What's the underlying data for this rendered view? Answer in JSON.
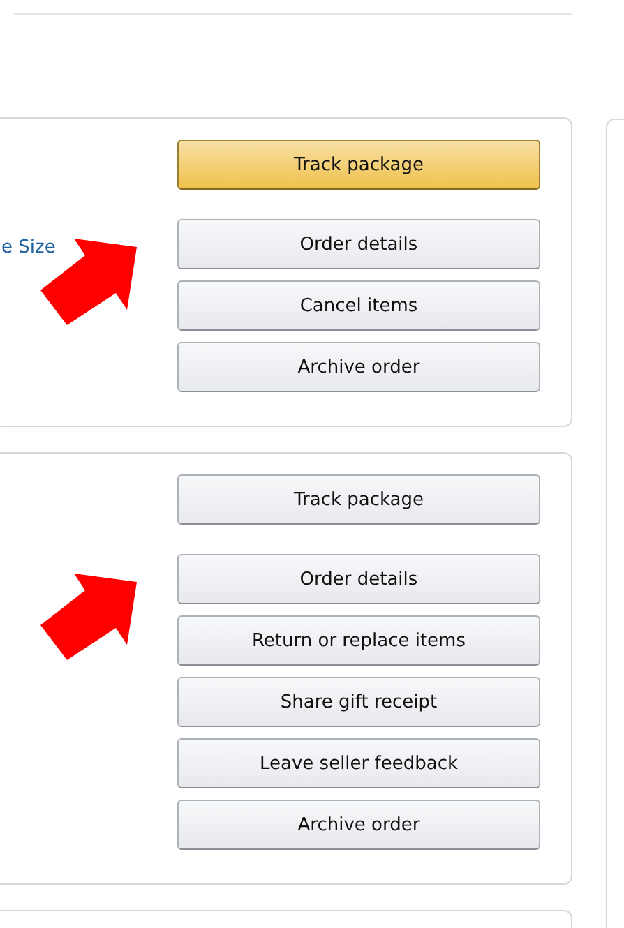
{
  "orders": [
    {
      "link": "e Size",
      "arrow": true,
      "primary_action": {
        "label": "Track package",
        "kind": "primary"
      },
      "actions": [
        {
          "label": "Order details"
        },
        {
          "label": "Cancel items"
        },
        {
          "label": "Archive order"
        }
      ]
    },
    {
      "arrow": true,
      "primary_action": {
        "label": "Track package",
        "kind": "secondary"
      },
      "actions": [
        {
          "label": "Order details"
        },
        {
          "label": "Return or replace items"
        },
        {
          "label": "Share gift receipt"
        },
        {
          "label": "Leave seller feedback"
        },
        {
          "label": "Archive order"
        }
      ]
    }
  ]
}
